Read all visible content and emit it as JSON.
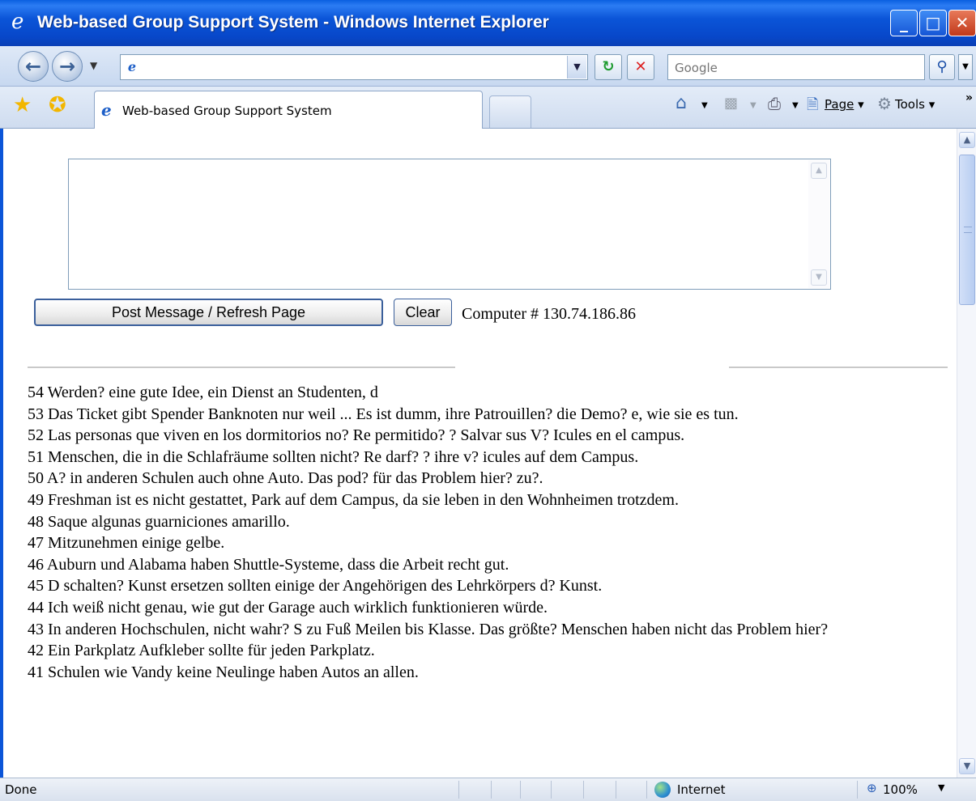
{
  "window": {
    "title": "Web-based Group Support System - Windows Internet Explorer",
    "controls": {
      "minimize": "_",
      "maximize": "□",
      "close": "✕"
    }
  },
  "toolbar": {
    "address_value": "",
    "search_placeholder": "Google"
  },
  "tabs": [
    {
      "label": "Web-based Group Support System"
    }
  ],
  "commands": {
    "page": "Page",
    "tools": "Tools"
  },
  "form": {
    "message_value": "",
    "post_button": "Post Message / Refresh Page",
    "clear_button": "Clear",
    "computer_label": "Computer # 130.74.186.86"
  },
  "messages": [
    "54 Werden? eine gute Idee, ein Dienst an Studenten, d",
    "53 Das Ticket gibt Spender Banknoten nur weil ... Es ist dumm, ihre Patrouillen? die Demo? e, wie sie es tun.",
    "52 Las personas que viven en los dormitorios no? Re permitido? ? Salvar sus V? Icules en el campus.",
    "51 Menschen, die in die Schlafräume sollten nicht? Re darf? ? ihre v? icules auf dem Campus.",
    "50 A? in anderen Schulen auch ohne Auto. Das pod? für das Problem hier? zu?.",
    "49 Freshman ist es nicht gestattet, Park auf dem Campus, da sie leben in den Wohnheimen trotzdem.",
    "48 Saque algunas guarniciones amarillo.",
    "47 Mitzunehmen einige gelbe.",
    "46 Auburn und Alabama haben Shuttle-Systeme, dass die Arbeit recht gut.",
    "45 D schalten? Kunst ersetzen sollten einige der Angehörigen des Lehrkörpers d? Kunst.",
    "44 Ich weiß nicht genau, wie gut der Garage auch wirklich funktionieren würde.",
    "43 In anderen Hochschulen, nicht wahr? S zu Fuß Meilen bis Klasse. Das größte? Menschen haben nicht das Problem hier?",
    "42 Ein Parkplatz Aufkleber sollte für jeden Parkplatz.",
    "41 Schulen wie Vandy keine Neulinge haben Autos an allen."
  ],
  "status": {
    "text": "Done",
    "zone": "Internet",
    "zoom": "100%"
  },
  "icons": {
    "back": "back-arrow-icon",
    "forward": "forward-arrow-icon",
    "refresh": "refresh-icon",
    "stop": "stop-icon",
    "search": "search-icon",
    "favorites": "favorites-star-icon",
    "add_favorites": "add-favorites-icon",
    "home": "home-icon",
    "feeds": "feeds-icon",
    "print": "print-icon",
    "page": "page-icon",
    "tools": "tools-gear-icon",
    "internet": "globe-icon",
    "zoom": "zoom-icon"
  }
}
